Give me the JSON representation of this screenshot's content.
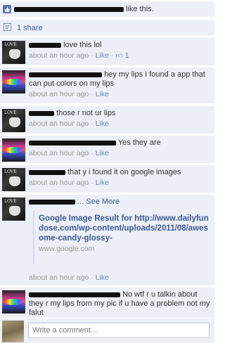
{
  "likes": {
    "text": "like this."
  },
  "shares": {
    "label": "1 share"
  },
  "comments": [
    {
      "text": "love this lol",
      "time": "about an hour ago",
      "like_label": "Like",
      "like_count": "1",
      "avatar": "love"
    },
    {
      "text": "hey my lips I found a app that can put colors on my lips",
      "time": "about an hour ago",
      "like_label": "Like",
      "avatar": "lips"
    },
    {
      "text": "those r not ur lips",
      "time": "about an hour ago",
      "like_label": "Like",
      "avatar": "love"
    },
    {
      "text": "Yes they are",
      "time": "about an hour ago",
      "like_label": "Like",
      "avatar": "lips"
    },
    {
      "text": "that y i found it on google images",
      "time": "about an hour ago",
      "like_label": "Like",
      "avatar": "love"
    },
    {
      "text": "... See More",
      "time": "about an hour ago",
      "like_label": "Like",
      "avatar": "love"
    },
    {
      "text": "No wtf r u talkin about they r my lips from my pic if u have a problem not my falut",
      "time": "about an hour ago",
      "like_label": "Like",
      "avatar": "lips"
    }
  ],
  "link_preview": {
    "title": "Google Image Result for http://www.dailyfundose.com/wp-content/uploads/2011/08/awesome-candy-glossy-",
    "domain": "www.google.com"
  },
  "composer": {
    "placeholder": "Write a comment..."
  },
  "colors": {
    "link": "#3b5998",
    "panel": "#eceff5",
    "border": "#e5eaf1"
  },
  "icons": [
    "like-thumb-icon",
    "share-icon",
    "thumbs-up-icon"
  ]
}
